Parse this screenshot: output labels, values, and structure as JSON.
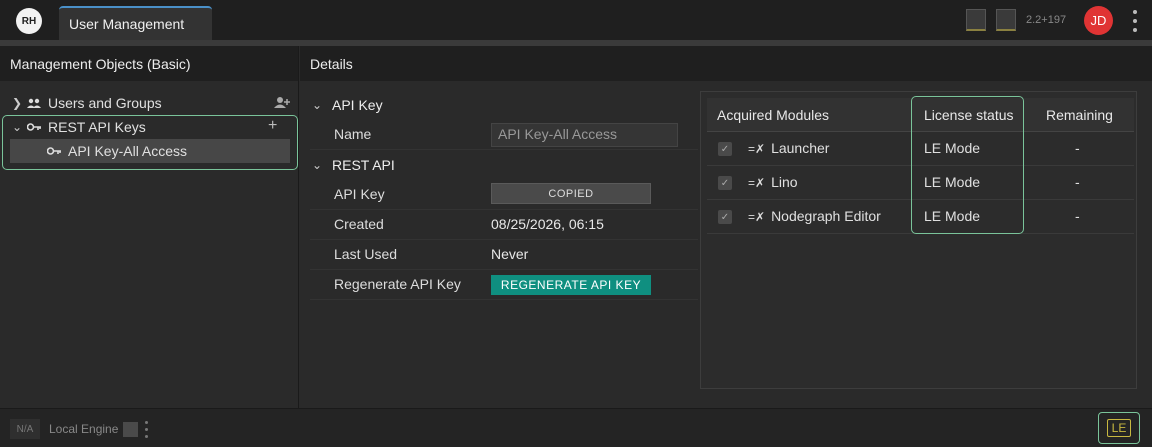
{
  "topbar": {
    "logo_text": "RH",
    "tab_label": "User Management",
    "version": "2.2+197",
    "user_initials": "JD",
    "colors": {
      "avatar": "#e03434",
      "tab_accent": "#4a90c8"
    }
  },
  "left": {
    "header": "Management Objects (Basic)",
    "items": [
      {
        "label": "Users and Groups",
        "expanded": false
      },
      {
        "label": "REST API Keys",
        "expanded": true
      },
      {
        "label": "API Key-All Access",
        "selected": true
      }
    ],
    "colors": {
      "highlight": "#7ac49a"
    }
  },
  "details": {
    "header": "Details",
    "section_api_key": "API Key",
    "name_label": "Name",
    "name_value": "API Key-All Access",
    "section_rest_api": "REST API",
    "api_key_label": "API Key",
    "api_key_button": "COPIED",
    "created_label": "Created",
    "created_value": "08/25/2026, 06:15",
    "last_used_label": "Last Used",
    "last_used_value": "Never",
    "regen_label": "Regenerate API Key",
    "regen_button": "REGENERATE API KEY",
    "colors": {
      "regen_button": "#0f8f80"
    }
  },
  "modules": {
    "headers": {
      "module": "Acquired Modules",
      "status": "License status",
      "remaining": "Remaining"
    },
    "rows": [
      {
        "name": "Launcher",
        "status": "LE Mode",
        "remaining": "-",
        "checked": true
      },
      {
        "name": "Lino",
        "status": "LE Mode",
        "remaining": "-",
        "checked": true
      },
      {
        "name": "Nodegraph Editor",
        "status": "LE Mode",
        "remaining": "-",
        "checked": true
      }
    ]
  },
  "bottombar": {
    "na": "N/A",
    "engine": "Local Engine",
    "le": "LE",
    "colors": {
      "le": "#c8b840"
    }
  }
}
